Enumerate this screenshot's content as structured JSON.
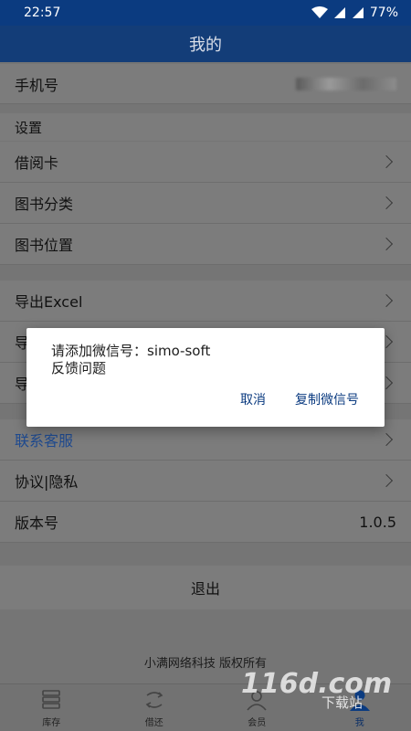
{
  "status": {
    "time": "22:57",
    "battery": "77%"
  },
  "header": {
    "title": "我的"
  },
  "phone_row": {
    "label": "手机号"
  },
  "settings_label": "设置",
  "settings_items": [
    {
      "label": "借阅卡"
    },
    {
      "label": "图书分类"
    },
    {
      "label": "图书位置"
    }
  ],
  "export_items": [
    {
      "label": "导出Excel"
    },
    {
      "label": "导"
    },
    {
      "label": "导"
    }
  ],
  "support_items": [
    {
      "label": "联系客服"
    },
    {
      "label": "协议|隐私"
    }
  ],
  "version": {
    "label": "版本号",
    "value": "1.0.5"
  },
  "logout": {
    "label": "退出"
  },
  "copyright": "小满网络科技 版权所有",
  "tabs": [
    {
      "label": "库存",
      "icon": "inventory-icon"
    },
    {
      "label": "借还",
      "icon": "borrow-return-icon"
    },
    {
      "label": "会员",
      "icon": "member-icon"
    },
    {
      "label": "我",
      "icon": "profile-icon"
    }
  ],
  "watermark": {
    "brand": "116d.com",
    "sub": "下载站"
  },
  "dialog": {
    "line1": "请添加微信号：simo-soft",
    "line2": "反馈问题",
    "cancel": "取消",
    "copy": "复制微信号"
  },
  "colors": {
    "accent": "#0b3b80",
    "link": "#1f4a8f"
  }
}
